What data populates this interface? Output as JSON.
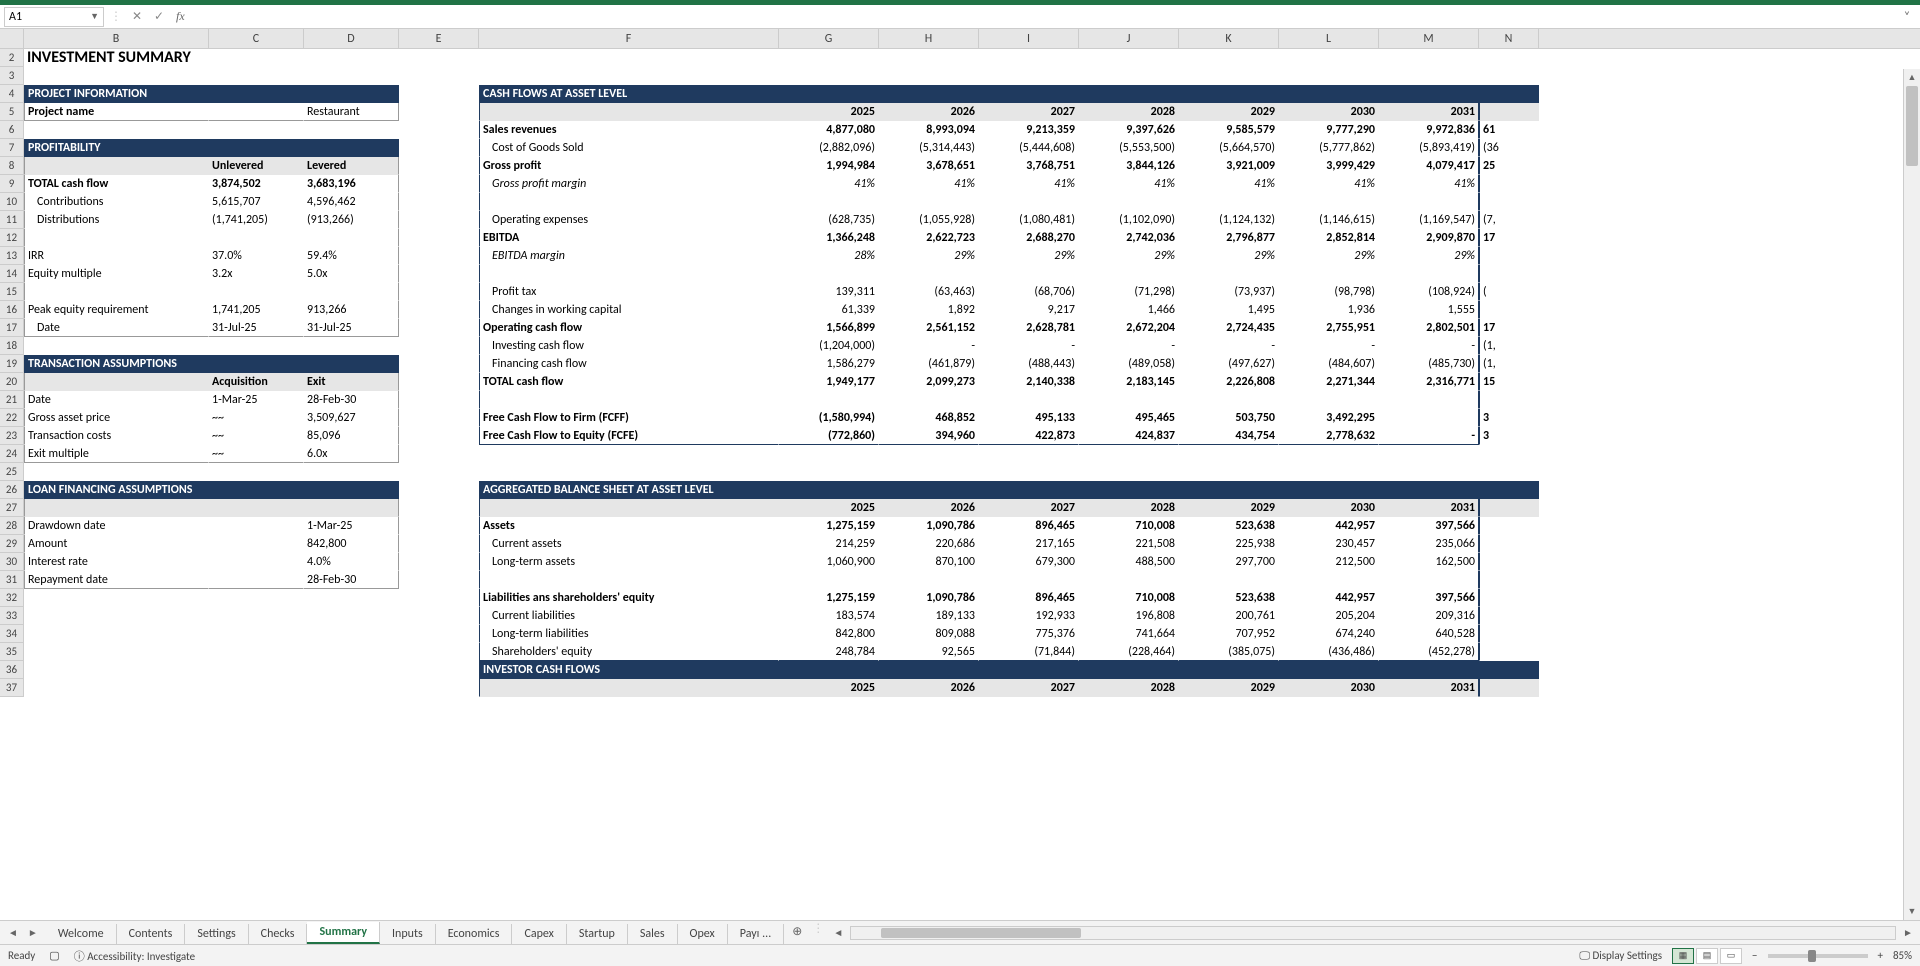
{
  "nameBox": "A1",
  "title": "INVESTMENT SUMMARY",
  "columns": [
    "B",
    "C",
    "D",
    "E",
    "F",
    "G",
    "H",
    "I",
    "J",
    "K",
    "L",
    "M",
    "N"
  ],
  "colWidths": {
    "B": 185,
    "C": 95,
    "D": 95,
    "E": 80,
    "F": 300,
    "G": 100,
    "H": 100,
    "I": 100,
    "J": 100,
    "K": 100,
    "L": 100,
    "M": 100,
    "N": 60
  },
  "left": {
    "projectInfoHead": "PROJECT INFORMATION",
    "projectNameLabel": "Project name",
    "projectName": "Restaurant",
    "profitHead": "PROFITABILITY",
    "profitCols": [
      "Unlevered",
      "Levered"
    ],
    "profitRows": [
      {
        "label": "TOTAL cash flow",
        "u": "3,874,502",
        "l": "3,683,196",
        "bold": true
      },
      {
        "label": "Contributions",
        "u": "5,615,707",
        "l": "4,596,462",
        "indent": 1
      },
      {
        "label": "Distributions",
        "u": "(1,741,205)",
        "l": "(913,266)",
        "indent": 1
      },
      {
        "label": "",
        "u": "",
        "l": ""
      },
      {
        "label": "IRR",
        "u": "37.0%",
        "l": "59.4%"
      },
      {
        "label": "Equity multiple",
        "u": "3.2x",
        "l": "5.0x"
      },
      {
        "label": "",
        "u": "",
        "l": ""
      },
      {
        "label": "Peak equity requirement",
        "u": "1,741,205",
        "l": "913,266"
      },
      {
        "label": "Date",
        "u": "31-Jul-25",
        "l": "31-Jul-25",
        "indent": 1
      }
    ],
    "transHead": "TRANSACTION ASSUMPTIONS",
    "transCols": [
      "Acquisition",
      "Exit"
    ],
    "transRows": [
      {
        "label": "Date",
        "a": "1-Mar-25",
        "e": "28-Feb-30"
      },
      {
        "label": "Gross asset price",
        "a": "~~",
        "e": "3,509,627"
      },
      {
        "label": "Transaction costs",
        "a": "~~",
        "e": "85,096"
      },
      {
        "label": "Exit multiple",
        "a": "~~",
        "e": "6.0x"
      }
    ],
    "loanHead": "LOAN FINANCING ASSUMPTIONS",
    "loanRows": [
      {
        "label": "",
        "v": ""
      },
      {
        "label": "Drawdown date",
        "v": "1-Mar-25"
      },
      {
        "label": "Amount",
        "v": "842,800"
      },
      {
        "label": "Interest rate",
        "v": "4.0%"
      },
      {
        "label": "Repayment date",
        "v": "28-Feb-30"
      }
    ]
  },
  "right": {
    "cfHead": "CASH FLOWS AT ASSET LEVEL",
    "years": [
      "2025",
      "2026",
      "2027",
      "2028",
      "2029",
      "2030",
      "2031"
    ],
    "cfRows": [
      {
        "label": "Sales revenues",
        "bold": true,
        "v": [
          "4,877,080",
          "8,993,094",
          "9,213,359",
          "9,397,626",
          "9,585,579",
          "9,777,290",
          "9,972,836"
        ],
        "n": "61"
      },
      {
        "label": "Cost of Goods Sold",
        "indent": 1,
        "v": [
          "(2,882,096)",
          "(5,314,443)",
          "(5,444,608)",
          "(5,553,500)",
          "(5,664,570)",
          "(5,777,862)",
          "(5,893,419)"
        ],
        "n": "(36"
      },
      {
        "label": "Gross profit",
        "bold": true,
        "v": [
          "1,994,984",
          "3,678,651",
          "3,768,751",
          "3,844,126",
          "3,921,009",
          "3,999,429",
          "4,079,417"
        ],
        "n": "25"
      },
      {
        "label": "Gross profit margin",
        "indent": 1,
        "italic": true,
        "v": [
          "41%",
          "41%",
          "41%",
          "41%",
          "41%",
          "41%",
          "41%"
        ],
        "n": ""
      },
      {
        "label": "",
        "v": [
          "",
          "",
          "",
          "",
          "",
          "",
          ""
        ],
        "n": ""
      },
      {
        "label": "Operating expenses",
        "indent": 1,
        "v": [
          "(628,735)",
          "(1,055,928)",
          "(1,080,481)",
          "(1,102,090)",
          "(1,124,132)",
          "(1,146,615)",
          "(1,169,547)"
        ],
        "n": "(7,"
      },
      {
        "label": "EBITDA",
        "bold": true,
        "v": [
          "1,366,248",
          "2,622,723",
          "2,688,270",
          "2,742,036",
          "2,796,877",
          "2,852,814",
          "2,909,870"
        ],
        "n": "17"
      },
      {
        "label": "EBITDA margin",
        "indent": 1,
        "italic": true,
        "v": [
          "28%",
          "29%",
          "29%",
          "29%",
          "29%",
          "29%",
          "29%"
        ],
        "n": ""
      },
      {
        "label": "",
        "v": [
          "",
          "",
          "",
          "",
          "",
          "",
          ""
        ],
        "n": ""
      },
      {
        "label": "Profit tax",
        "indent": 1,
        "v": [
          "139,311",
          "(63,463)",
          "(68,706)",
          "(71,298)",
          "(73,937)",
          "(98,798)",
          "(108,924)"
        ],
        "n": "("
      },
      {
        "label": "Changes in working capital",
        "indent": 1,
        "v": [
          "61,339",
          "1,892",
          "9,217",
          "1,466",
          "1,495",
          "1,936",
          "1,555"
        ],
        "n": ""
      },
      {
        "label": "Operating cash flow",
        "bold": true,
        "v": [
          "1,566,899",
          "2,561,152",
          "2,628,781",
          "2,672,204",
          "2,724,435",
          "2,755,951",
          "2,802,501"
        ],
        "n": "17"
      },
      {
        "label": "Investing cash flow",
        "indent": 1,
        "v": [
          "(1,204,000)",
          "-",
          "-",
          "-",
          "-",
          "-",
          "-"
        ],
        "n": "(1,"
      },
      {
        "label": "Financing cash flow",
        "indent": 1,
        "v": [
          "1,586,279",
          "(461,879)",
          "(488,443)",
          "(489,058)",
          "(497,627)",
          "(484,607)",
          "(485,730)"
        ],
        "n": "(1,"
      },
      {
        "label": "TOTAL cash flow",
        "bold": true,
        "v": [
          "1,949,177",
          "2,099,273",
          "2,140,338",
          "2,183,145",
          "2,226,808",
          "2,271,344",
          "2,316,771"
        ],
        "n": "15"
      },
      {
        "label": "",
        "v": [
          "",
          "",
          "",
          "",
          "",
          "",
          ""
        ],
        "n": ""
      },
      {
        "label": "Free Cash Flow to Firm (FCFF)",
        "bold": true,
        "v": [
          "(1,580,994)",
          "468,852",
          "495,133",
          "495,465",
          "503,750",
          "3,492,295",
          ""
        ],
        "n": "3"
      },
      {
        "label": "Free Cash Flow to Equity (FCFE)",
        "bold": true,
        "v": [
          "(772,860)",
          "394,960",
          "422,873",
          "424,837",
          "434,754",
          "2,778,632",
          "-"
        ],
        "n": "3"
      }
    ],
    "bsHead": "AGGREGATED BALANCE SHEET AT ASSET LEVEL",
    "bsRows": [
      {
        "label": "Assets",
        "bold": true,
        "v": [
          "1,275,159",
          "1,090,786",
          "896,465",
          "710,008",
          "523,638",
          "442,957",
          "397,566"
        ],
        "n": ""
      },
      {
        "label": "Current assets",
        "indent": 1,
        "v": [
          "214,259",
          "220,686",
          "217,165",
          "221,508",
          "225,938",
          "230,457",
          "235,066"
        ],
        "n": ""
      },
      {
        "label": "Long-term assets",
        "indent": 1,
        "v": [
          "1,060,900",
          "870,100",
          "679,300",
          "488,500",
          "297,700",
          "212,500",
          "162,500"
        ],
        "n": ""
      },
      {
        "label": "",
        "v": [
          "",
          "",
          "",
          "",
          "",
          "",
          ""
        ],
        "n": ""
      },
      {
        "label": "Liabilities ans shareholders' equity",
        "bold": true,
        "v": [
          "1,275,159",
          "1,090,786",
          "896,465",
          "710,008",
          "523,638",
          "442,957",
          "397,566"
        ],
        "n": ""
      },
      {
        "label": "Current liabilities",
        "indent": 1,
        "v": [
          "183,574",
          "189,133",
          "192,933",
          "196,808",
          "200,761",
          "205,204",
          "209,316"
        ],
        "n": ""
      },
      {
        "label": "Long-term liabilities",
        "indent": 1,
        "v": [
          "842,800",
          "809,088",
          "775,376",
          "741,664",
          "707,952",
          "674,240",
          "640,528"
        ],
        "n": ""
      },
      {
        "label": "Shareholders' equity",
        "indent": 1,
        "v": [
          "248,784",
          "92,565",
          "(71,844)",
          "(228,464)",
          "(385,075)",
          "(436,486)",
          "(452,278)"
        ],
        "n": ""
      }
    ],
    "investorHead": "INVESTOR CASH FLOWS"
  },
  "tabs": [
    "Welcome",
    "Contents",
    "Settings",
    "Checks",
    "Summary",
    "Inputs",
    "Economics",
    "Capex",
    "Startup",
    "Sales",
    "Opex",
    "Payı ..."
  ],
  "activeTab": "Summary",
  "status": {
    "ready": "Ready",
    "accessibility": "Accessibility: Investigate",
    "displaySettings": "Display Settings",
    "zoom": "85%"
  },
  "chart_data": {
    "type": "table",
    "title": "Cash Flows at Asset Level",
    "categories": [
      "2025",
      "2026",
      "2027",
      "2028",
      "2029",
      "2030",
      "2031"
    ],
    "series": [
      {
        "name": "Sales revenues",
        "values": [
          4877080,
          8993094,
          9213359,
          9397626,
          9585579,
          9777290,
          9972836
        ]
      },
      {
        "name": "Cost of Goods Sold",
        "values": [
          -2882096,
          -5314443,
          -5444608,
          -5553500,
          -5664570,
          -5777862,
          -5893419
        ]
      },
      {
        "name": "Gross profit",
        "values": [
          1994984,
          3678651,
          3768751,
          3844126,
          3921009,
          3999429,
          4079417
        ]
      },
      {
        "name": "Operating expenses",
        "values": [
          -628735,
          -1055928,
          -1080481,
          -1102090,
          -1124132,
          -1146615,
          -1169547
        ]
      },
      {
        "name": "EBITDA",
        "values": [
          1366248,
          2622723,
          2688270,
          2742036,
          2796877,
          2852814,
          2909870
        ]
      },
      {
        "name": "Operating cash flow",
        "values": [
          1566899,
          2561152,
          2628781,
          2672204,
          2724435,
          2755951,
          2802501
        ]
      },
      {
        "name": "TOTAL cash flow",
        "values": [
          1949177,
          2099273,
          2140338,
          2183145,
          2226808,
          2271344,
          2316771
        ]
      },
      {
        "name": "FCFF",
        "values": [
          -1580994,
          468852,
          495133,
          495465,
          503750,
          3492295,
          null
        ]
      },
      {
        "name": "FCFE",
        "values": [
          -772860,
          394960,
          422873,
          424837,
          434754,
          2778632,
          null
        ]
      }
    ]
  }
}
